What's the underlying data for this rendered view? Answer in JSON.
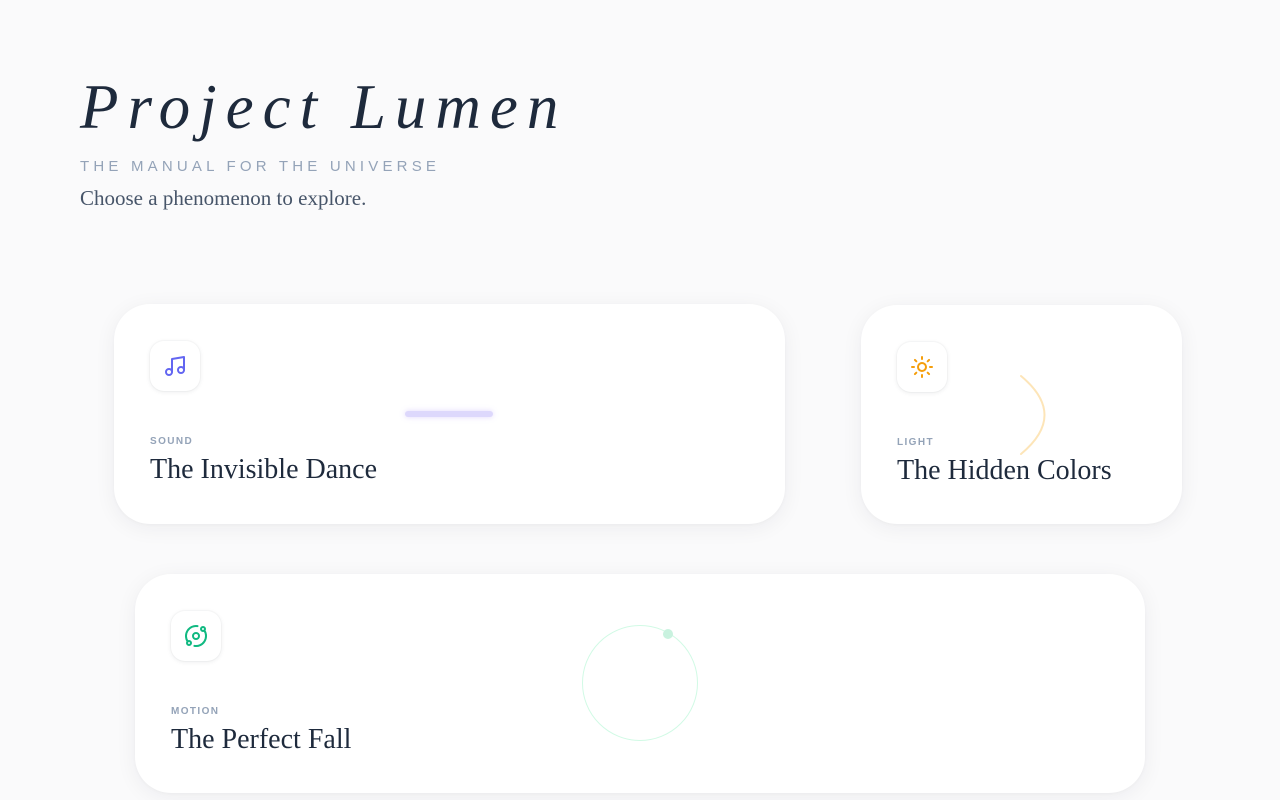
{
  "header": {
    "title": "Project Lumen",
    "subtitle": "THE MANUAL FOR THE UNIVERSE",
    "prompt": "Choose a phenomenon to explore."
  },
  "cards": [
    {
      "category": "SOUND",
      "title": "The Invisible Dance",
      "icon": "music-note-icon",
      "accent": "#6366f1"
    },
    {
      "category": "LIGHT",
      "title": "The Hidden Colors",
      "icon": "sun-icon",
      "accent": "#f59e0b"
    },
    {
      "category": "MOTION",
      "title": "The Perfect Fall",
      "icon": "orbit-icon",
      "accent": "#10b981"
    }
  ]
}
